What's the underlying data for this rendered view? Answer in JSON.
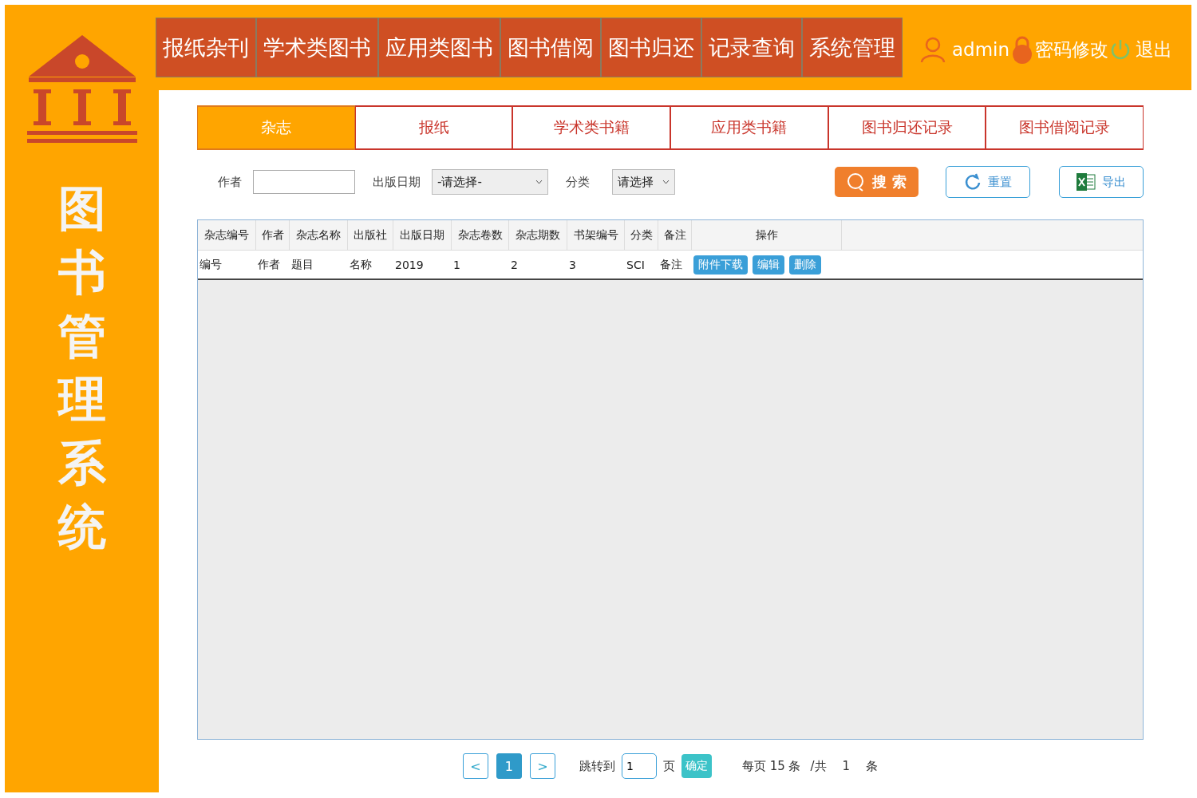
{
  "sidebar": {
    "title": "图书管理系统"
  },
  "nav": [
    {
      "label": "报纸杂刊"
    },
    {
      "label": "学术类图书"
    },
    {
      "label": "应用类图书"
    },
    {
      "label": "图书借阅"
    },
    {
      "label": "图书归还"
    },
    {
      "label": "记录查询"
    },
    {
      "label": "系统管理"
    }
  ],
  "user": {
    "name": "admin",
    "change_password": "密码修改",
    "logout": "退出"
  },
  "subtabs": [
    {
      "label": "杂志",
      "selected": true
    },
    {
      "label": "报纸",
      "selected": false
    },
    {
      "label": "学术类书籍",
      "selected": false
    },
    {
      "label": "应用类书籍",
      "selected": false
    },
    {
      "label": "图书归还记录",
      "selected": false
    },
    {
      "label": "图书借阅记录",
      "selected": false
    }
  ],
  "filters": {
    "author_label": "作者",
    "date_label": "出版日期",
    "date_value": "-请选择-",
    "category_label": "分类",
    "category_value": "请选择"
  },
  "buttons": {
    "search": "搜 索",
    "reset": "重置",
    "export": "导出"
  },
  "table": {
    "columns": [
      "杂志编号",
      "作者",
      "杂志名称",
      "出版社",
      "出版日期",
      "杂志卷数",
      "杂志期数",
      "书架编号",
      "分类",
      "备注",
      "操作"
    ],
    "rows": [
      {
        "cells": [
          "编号",
          "作者",
          "题目",
          "名称",
          "2019",
          "1",
          "2",
          "3",
          "SCI",
          "备注"
        ],
        "actions": [
          "附件下载",
          "编辑",
          "删除"
        ]
      }
    ]
  },
  "pagination": {
    "prev": "<",
    "pages": [
      {
        "label": "1",
        "selected": true
      }
    ],
    "next": ">",
    "jump_label": "跳转到",
    "jump_value": "1",
    "page_unit": "页",
    "confirm": "确定",
    "per_page": "每页 15 条",
    "total_label": "/共",
    "total": "1",
    "total_unit": "条"
  }
}
